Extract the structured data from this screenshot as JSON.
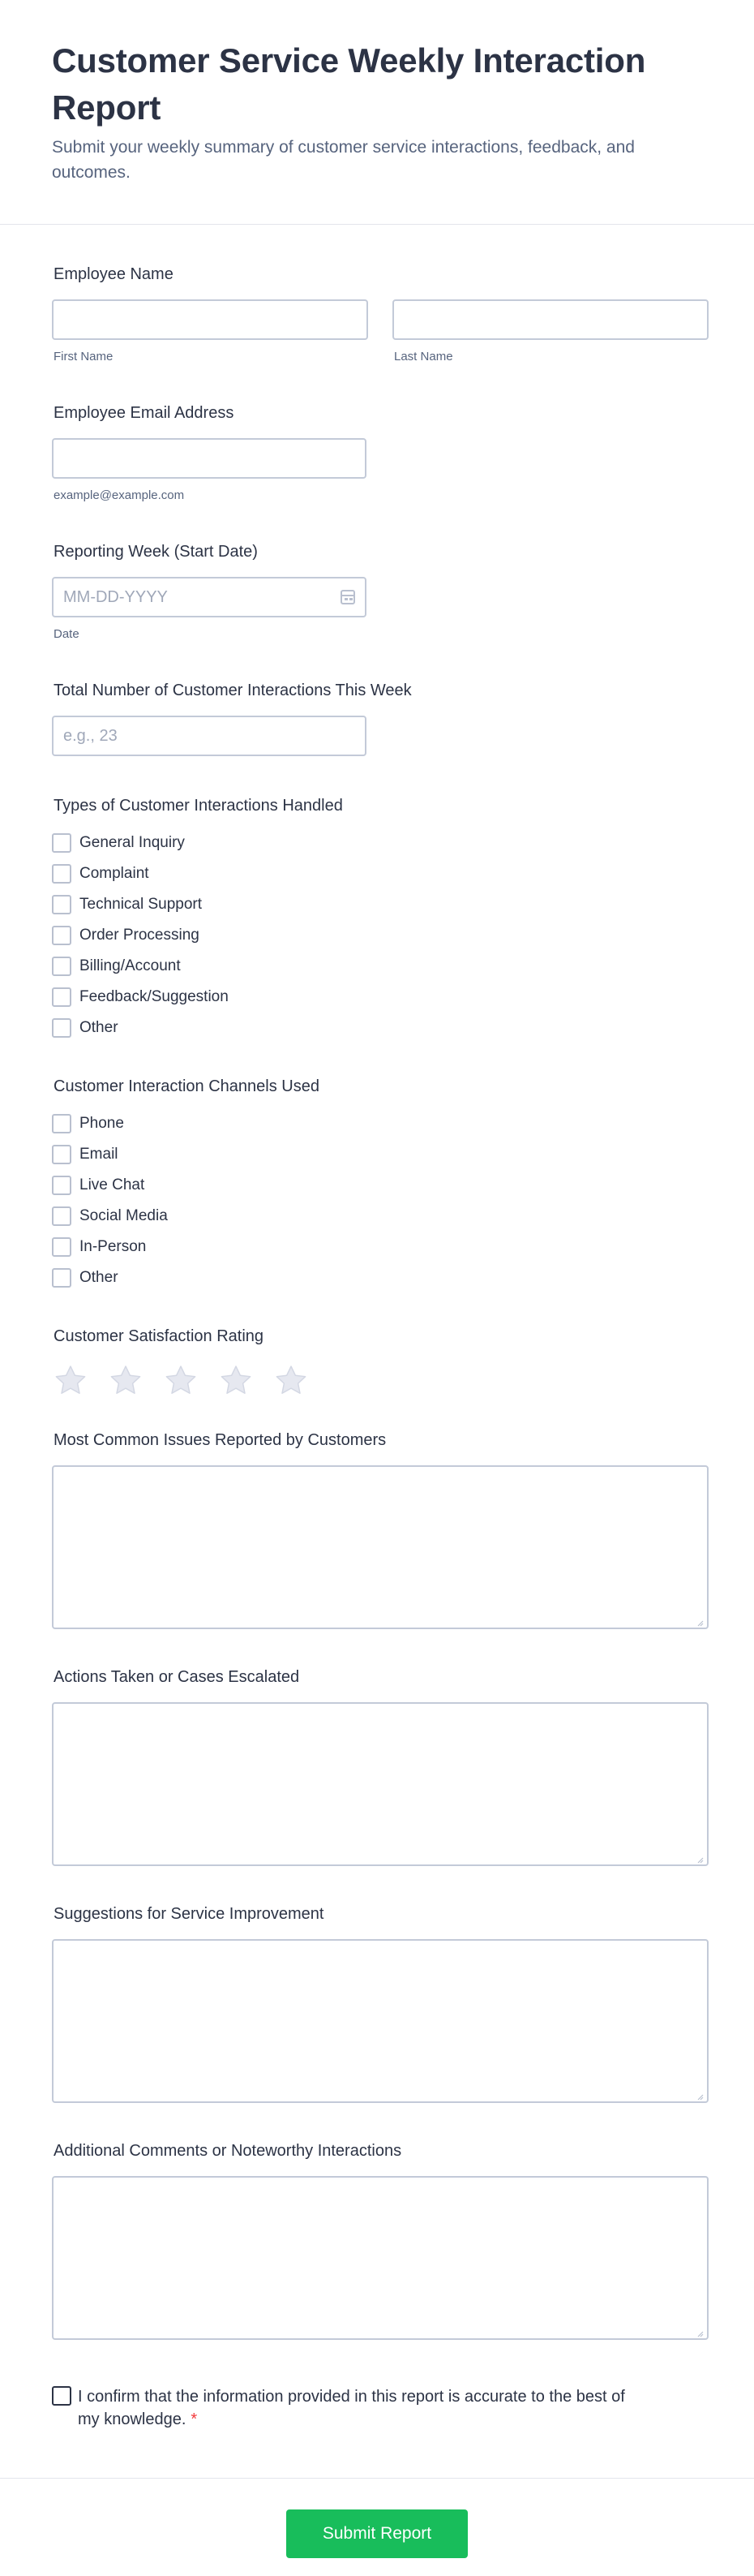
{
  "header": {
    "title": "Customer Service Weekly Interaction Report",
    "subtitle": "Submit your weekly summary of customer service interactions, feedback, and outcomes."
  },
  "employee_name": {
    "label": "Employee Name",
    "first": {
      "value": "",
      "sublabel": "First Name"
    },
    "last": {
      "value": "",
      "sublabel": "Last Name"
    }
  },
  "email": {
    "label": "Employee Email Address",
    "value": "",
    "sublabel": "example@example.com"
  },
  "reporting_week": {
    "label": "Reporting Week (Start Date)",
    "placeholder": "MM-DD-YYYY",
    "sublabel": "Date",
    "icon": "calendar-icon"
  },
  "total_interactions": {
    "label": "Total Number of Customer Interactions This Week",
    "placeholder": "e.g., 23"
  },
  "interaction_types": {
    "label": "Types of Customer Interactions Handled",
    "options": [
      "General Inquiry",
      "Complaint",
      "Technical Support",
      "Order Processing",
      "Billing/Account",
      "Feedback/Suggestion",
      "Other"
    ]
  },
  "channels": {
    "label": "Customer Interaction Channels Used",
    "options": [
      "Phone",
      "Email",
      "Live Chat",
      "Social Media",
      "In-Person",
      "Other"
    ]
  },
  "satisfaction": {
    "label": "Customer Satisfaction Rating",
    "max": 5,
    "value": 0,
    "icon": "star-icon"
  },
  "common_issues": {
    "label": "Most Common Issues Reported by Customers",
    "value": ""
  },
  "actions": {
    "label": "Actions Taken or Cases Escalated",
    "value": ""
  },
  "suggestions": {
    "label": "Suggestions for Service Improvement",
    "value": ""
  },
  "comments": {
    "label": "Additional Comments or Noteworthy Interactions",
    "value": ""
  },
  "confirm": {
    "label": "I confirm that the information provided in this report is accurate to the best of my knowledge.",
    "required_mark": "*"
  },
  "submit": {
    "label": "Submit Report"
  },
  "colors": {
    "accent": "#18bd5b",
    "required": "#f23a3c",
    "text": "#2c3345",
    "border": "#c3cad8"
  }
}
